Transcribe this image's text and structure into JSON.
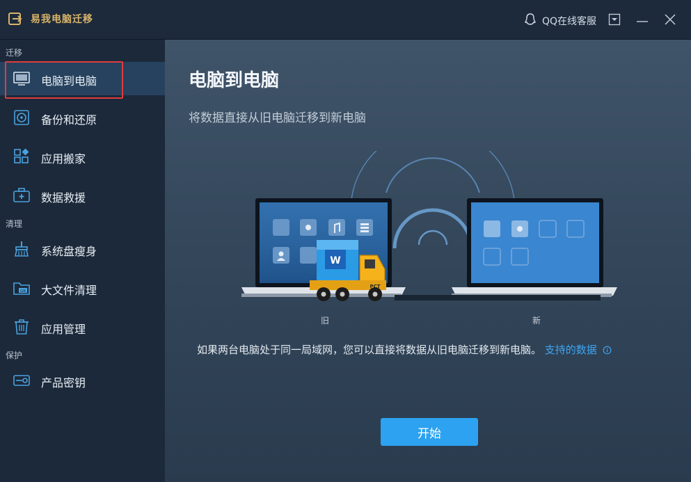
{
  "app": {
    "title": "易我电脑迁移",
    "brand_color": "#d9b46a"
  },
  "titlebar": {
    "support_label": "QQ在线客服",
    "icons": [
      "qq-icon",
      "menu-dropdown-icon",
      "minimize-icon",
      "close-icon"
    ]
  },
  "sidebar": {
    "sections": [
      {
        "label": "迁移",
        "items": [
          {
            "label": "电脑到电脑",
            "icon": "monitor-icon",
            "active": true
          },
          {
            "label": "备份和还原",
            "icon": "backup-disk-icon"
          },
          {
            "label": "应用搬家",
            "icon": "app-grid-icon"
          },
          {
            "label": "数据救援",
            "icon": "rescue-kit-icon"
          }
        ]
      },
      {
        "label": "清理",
        "items": [
          {
            "label": "系统盘瘦身",
            "icon": "broom-icon"
          },
          {
            "label": "大文件清理",
            "icon": "gb-folder-icon"
          },
          {
            "label": "应用管理",
            "icon": "trash-icon"
          }
        ]
      },
      {
        "label": "保护",
        "items": [
          {
            "label": "产品密钥",
            "icon": "key-icon"
          }
        ]
      }
    ]
  },
  "main": {
    "title": "电脑到电脑",
    "subtitle": "将数据直接从旧电脑迁移到新电脑",
    "old_label": "旧",
    "new_label": "新",
    "truck_label": "PCT",
    "info_text": "如果两台电脑处于同一局域网，您可以直接将数据从旧电脑迁移到新电脑。",
    "info_link": "支持的数据",
    "start_button": "开始",
    "accent_color": "#2da2f0"
  }
}
